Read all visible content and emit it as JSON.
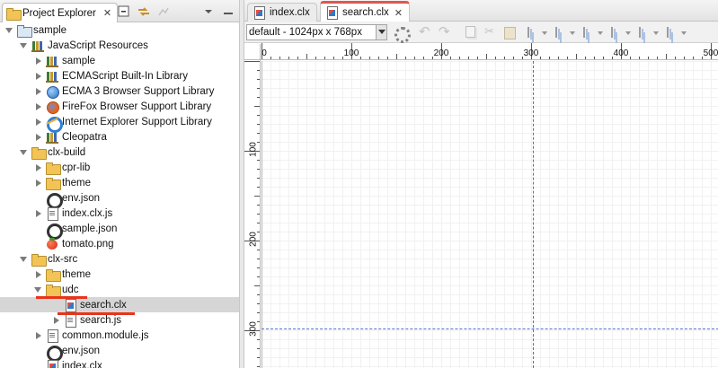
{
  "project_explorer": {
    "tab_label": "Project Explorer",
    "tree": [
      {
        "label": "sample",
        "icon": "project-icon",
        "depth": 0,
        "state": "expanded"
      },
      {
        "label": "JavaScript Resources",
        "icon": "library-icon",
        "depth": 1,
        "state": "expanded"
      },
      {
        "label": "sample",
        "icon": "library-icon",
        "depth": 2,
        "state": "collapsed"
      },
      {
        "label": "ECMAScript Built-In Library",
        "icon": "library-icon",
        "depth": 2,
        "state": "collapsed"
      },
      {
        "label": "ECMA 3 Browser Support Library",
        "icon": "globe-icon",
        "depth": 2,
        "state": "collapsed"
      },
      {
        "label": "FireFox Browser Support Library",
        "icon": "firefox-icon",
        "depth": 2,
        "state": "collapsed"
      },
      {
        "label": "Internet Explorer Support Library",
        "icon": "ie-icon",
        "depth": 2,
        "state": "collapsed"
      },
      {
        "label": "Cleopatra",
        "icon": "library-icon",
        "depth": 2,
        "state": "collapsed"
      },
      {
        "label": "clx-build",
        "icon": "folder-icon",
        "depth": 1,
        "state": "expanded"
      },
      {
        "label": "cpr-lib",
        "icon": "folder-icon",
        "depth": 2,
        "state": "collapsed"
      },
      {
        "label": "theme",
        "icon": "folder-icon",
        "depth": 2,
        "state": "collapsed"
      },
      {
        "label": "env.json",
        "icon": "json-file-icon",
        "depth": 2,
        "state": "leaf"
      },
      {
        "label": "index.clx.js",
        "icon": "js-file-icon",
        "depth": 2,
        "state": "collapsed"
      },
      {
        "label": "sample.json",
        "icon": "json-file-icon",
        "depth": 2,
        "state": "leaf"
      },
      {
        "label": "tomato.png",
        "icon": "tomato-image-icon",
        "depth": 2,
        "state": "leaf"
      },
      {
        "label": "clx-src",
        "icon": "folder-icon",
        "depth": 1,
        "state": "expanded"
      },
      {
        "label": "theme",
        "icon": "folder-icon",
        "depth": 2,
        "state": "collapsed"
      },
      {
        "label": "udc",
        "icon": "folder-icon",
        "depth": 2,
        "state": "expanded"
      },
      {
        "label": "search.clx",
        "icon": "clx-file-icon",
        "depth": 3,
        "state": "leaf",
        "selected": true
      },
      {
        "label": "search.js",
        "icon": "js-file-icon",
        "depth": 3,
        "state": "collapsed"
      },
      {
        "label": "common.module.js",
        "icon": "js-file-icon",
        "depth": 2,
        "state": "collapsed"
      },
      {
        "label": "env.json",
        "icon": "json-file-icon",
        "depth": 2,
        "state": "leaf"
      },
      {
        "label": "index.clx",
        "icon": "clx-file-icon",
        "depth": 2,
        "state": "leaf"
      }
    ]
  },
  "editor": {
    "tabs": [
      {
        "label": "index.clx",
        "active": false
      },
      {
        "label": "search.clx",
        "active": true
      }
    ],
    "screen_size_select": "default - 1024px x 768px",
    "ruler": {
      "h_labels": [
        "0",
        "100",
        "200",
        "300",
        "400",
        "500"
      ],
      "v_labels": [
        "100",
        "200",
        "300"
      ]
    }
  },
  "colors": {
    "highlight_underline": "#e8341c",
    "active_tab_accent": "#e05650",
    "guide_line": "#4b6fd0",
    "selection_bg": "#d6d6d6"
  }
}
